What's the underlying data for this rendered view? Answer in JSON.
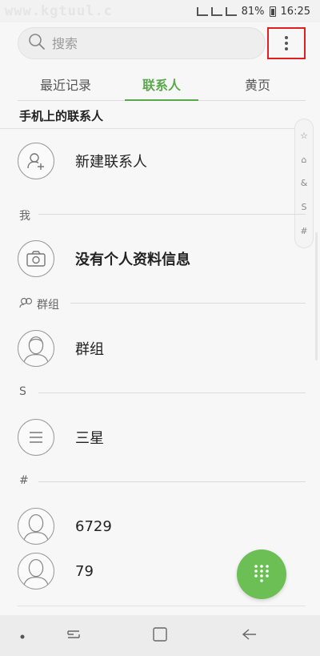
{
  "status_bar": {
    "watermark": "www.kgtuul.c",
    "battery": "81%",
    "time": "16:25"
  },
  "search": {
    "placeholder": "搜索",
    "icon": "search-icon"
  },
  "more_menu": {
    "icon": "more-vertical-icon"
  },
  "tabs": [
    {
      "label": "最近记录",
      "active": false
    },
    {
      "label": "联系人",
      "active": true
    },
    {
      "label": "黄页",
      "active": false
    }
  ],
  "section_title": "手机上的联系人",
  "new_contact": {
    "label": "新建联系人",
    "icon": "add-person-icon"
  },
  "sections": {
    "me": "我",
    "groups": "群组",
    "s": "S",
    "hash": "#"
  },
  "profile": {
    "label": "没有个人资料信息",
    "icon": "camera-icon"
  },
  "group_item": {
    "label": "群组"
  },
  "samsung_item": {
    "label": "三星"
  },
  "contacts": [
    {
      "label": "6729"
    },
    {
      "label": "79"
    }
  ],
  "index_bar": [
    "☆",
    "⌂",
    "&",
    "S",
    "#"
  ],
  "colors": {
    "accent": "#5aa84c",
    "fab": "#6cbf54",
    "highlight_border": "#e02020"
  },
  "fab": {
    "icon": "dialpad-icon"
  },
  "nav": {
    "dot": "nav-dot-icon",
    "recent": "recent-apps-icon",
    "home": "home-icon",
    "back": "back-icon"
  }
}
